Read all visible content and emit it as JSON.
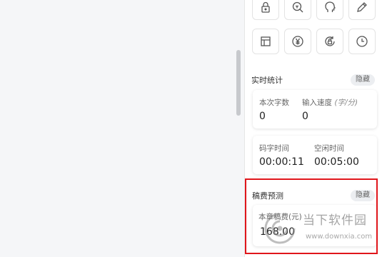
{
  "toolbar": {
    "row1": [
      {
        "icon": "lock-icon"
      },
      {
        "icon": "search-zoom-icon"
      },
      {
        "icon": "head-profile-icon"
      },
      {
        "icon": "pencil-icon"
      }
    ],
    "row2": [
      {
        "icon": "table-layout-icon"
      },
      {
        "icon": "yen-icon"
      },
      {
        "icon": "autosave-lock-icon"
      },
      {
        "icon": "clock-icon"
      }
    ]
  },
  "realtime_stats": {
    "title": "实时统计",
    "hide_label": "隐藏",
    "words_label": "本次字数",
    "words_value": "0",
    "speed_label": "输入速度",
    "speed_unit": "(字/分)",
    "speed_value": "0",
    "typing_time_label": "码字时间",
    "typing_time_value": "00:00:11",
    "idle_time_label": "空闲时间",
    "idle_time_value": "00:05:00"
  },
  "fee_forecast": {
    "title": "稿费预测",
    "hide_label": "隐藏",
    "label": "本章稿费(元)",
    "value": "168.00"
  },
  "watermark": {
    "name": "当下软件园",
    "url": "www.downxia.com"
  },
  "colors": {
    "highlight": "#e0161b",
    "panel_bg": "#ffffff",
    "page_bg": "#f5f6f8"
  }
}
